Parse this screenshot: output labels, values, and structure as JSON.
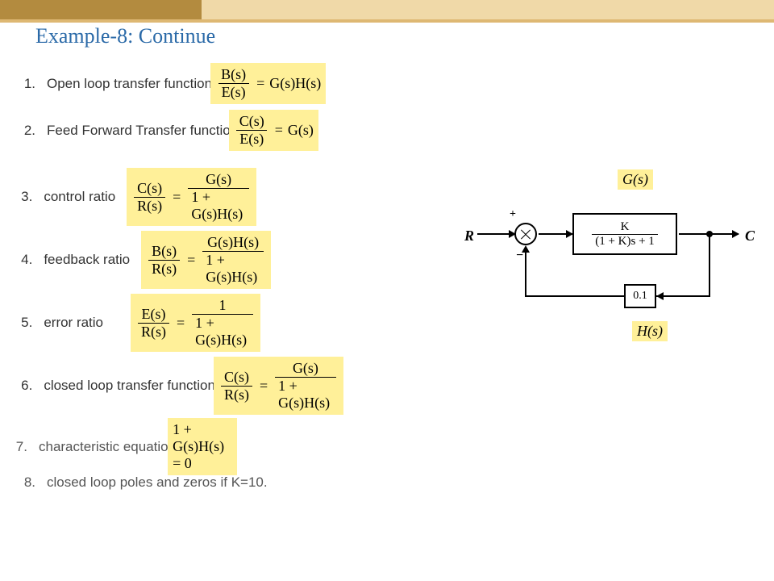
{
  "title": "Example-8: Continue",
  "items": [
    {
      "n": "1.",
      "label": "Open loop transfer function",
      "lhs_top": "B(s)",
      "lhs_bot": "E(s)",
      "rhs": "G(s)H(s)",
      "type": "simple"
    },
    {
      "n": "2.",
      "label": "Feed Forward Transfer functio",
      "lhs_top": "C(s)",
      "lhs_bot": "E(s)",
      "rhs": "G(s)",
      "type": "simple"
    },
    {
      "n": "3.",
      "label": "control ratio",
      "lhs_top": "C(s)",
      "lhs_bot": "R(s)",
      "rhs_top": "G(s)",
      "rhs_bot": "1 + G(s)H(s)",
      "type": "frac"
    },
    {
      "n": "4.",
      "label": "feedback ratio",
      "lhs_top": "B(s)",
      "lhs_bot": "R(s)",
      "rhs_top": "G(s)H(s)",
      "rhs_bot": "1 + G(s)H(s)",
      "type": "frac"
    },
    {
      "n": "5.",
      "label": "error ratio",
      "lhs_top": "E(s)",
      "lhs_bot": "R(s)",
      "rhs_top": "1",
      "rhs_bot": "1 + G(s)H(s)",
      "type": "frac"
    },
    {
      "n": "6.",
      "label": "closed loop transfer function",
      "lhs_top": "C(s)",
      "lhs_bot": "R(s)",
      "rhs_top": "G(s)",
      "rhs_bot": "1 + G(s)H(s)",
      "type": "frac"
    },
    {
      "n": "7.",
      "label": "characteristic equation",
      "expr": "1 + G(s)H(s) = 0",
      "type": "plain"
    },
    {
      "n": "8.",
      "label": "closed loop poles and zeros if K=10.",
      "type": "none"
    }
  ],
  "diagram": {
    "input": "R",
    "output": "C",
    "plus": "+",
    "minus": "−",
    "plant_top": "K",
    "plant_bot": "(1 + K)s + 1",
    "feedback": "0.1",
    "g_label": "G(s)",
    "h_label": "H(s)"
  }
}
